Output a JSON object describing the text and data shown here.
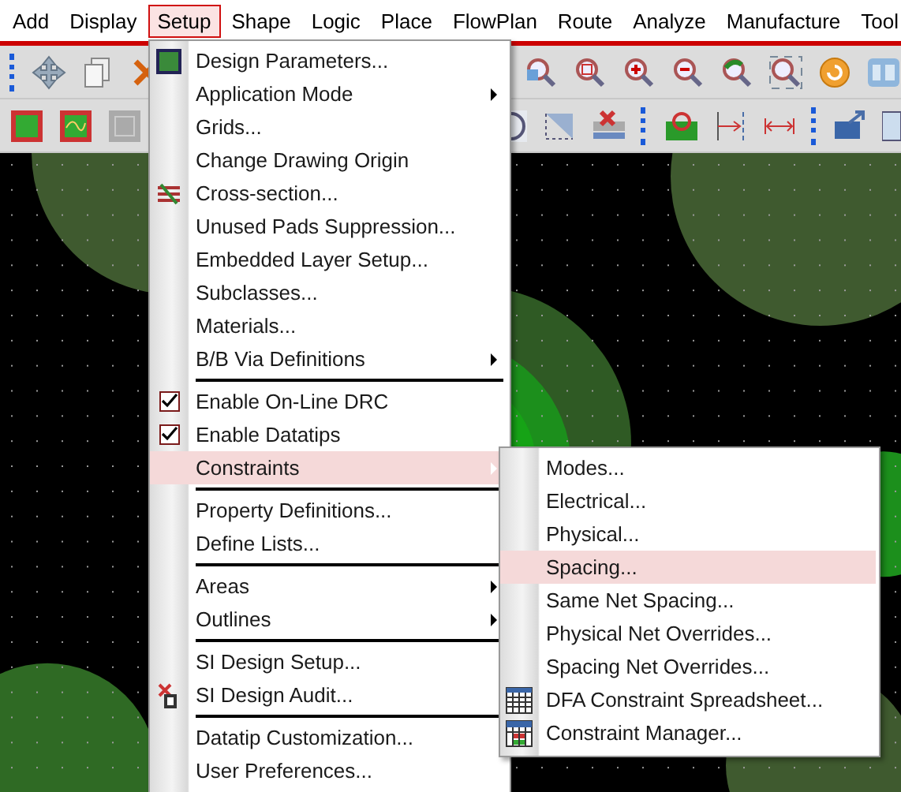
{
  "menu_bar": [
    {
      "label": "Add",
      "selected": false
    },
    {
      "label": "Display",
      "selected": false
    },
    {
      "label": "Setup",
      "selected": true
    },
    {
      "label": "Shape",
      "selected": false
    },
    {
      "label": "Logic",
      "selected": false
    },
    {
      "label": "Place",
      "selected": false
    },
    {
      "label": "FlowPlan",
      "selected": false
    },
    {
      "label": "Route",
      "selected": false
    },
    {
      "label": "Analyze",
      "selected": false
    },
    {
      "label": "Manufacture",
      "selected": false
    },
    {
      "label": "Tool",
      "selected": false
    }
  ],
  "setup_menu": [
    {
      "kind": "item",
      "label": "Design Parameters...",
      "submenu": false,
      "checked": false,
      "selected": false
    },
    {
      "kind": "item",
      "label": "Application Mode",
      "submenu": true,
      "checked": false,
      "selected": false
    },
    {
      "kind": "item",
      "label": "Grids...",
      "submenu": false,
      "checked": false,
      "selected": false
    },
    {
      "kind": "item",
      "label": "Change Drawing Origin",
      "submenu": false,
      "checked": false,
      "selected": false
    },
    {
      "kind": "item",
      "label": "Cross-section...",
      "submenu": false,
      "checked": false,
      "selected": false
    },
    {
      "kind": "item",
      "label": "Unused Pads Suppression...",
      "submenu": false,
      "checked": false,
      "selected": false
    },
    {
      "kind": "item",
      "label": "Embedded Layer Setup...",
      "submenu": false,
      "checked": false,
      "selected": false
    },
    {
      "kind": "item",
      "label": "Subclasses...",
      "submenu": false,
      "checked": false,
      "selected": false
    },
    {
      "kind": "item",
      "label": "Materials...",
      "submenu": false,
      "checked": false,
      "selected": false
    },
    {
      "kind": "item",
      "label": "B/B Via Definitions",
      "submenu": true,
      "checked": false,
      "selected": false
    },
    {
      "kind": "separator"
    },
    {
      "kind": "item",
      "label": "Enable On-Line DRC",
      "submenu": false,
      "checked": true,
      "selected": false
    },
    {
      "kind": "item",
      "label": "Enable Datatips",
      "submenu": false,
      "checked": true,
      "selected": false
    },
    {
      "kind": "item",
      "label": "Constraints",
      "submenu": true,
      "checked": false,
      "selected": true
    },
    {
      "kind": "separator"
    },
    {
      "kind": "item",
      "label": "Property Definitions...",
      "submenu": false,
      "checked": false,
      "selected": false
    },
    {
      "kind": "item",
      "label": "Define Lists...",
      "submenu": false,
      "checked": false,
      "selected": false
    },
    {
      "kind": "separator"
    },
    {
      "kind": "item",
      "label": "Areas",
      "submenu": true,
      "checked": false,
      "selected": false
    },
    {
      "kind": "item",
      "label": "Outlines",
      "submenu": true,
      "checked": false,
      "selected": false
    },
    {
      "kind": "separator"
    },
    {
      "kind": "item",
      "label": "SI Design Setup...",
      "submenu": false,
      "checked": false,
      "selected": false
    },
    {
      "kind": "item",
      "label": "SI Design Audit...",
      "submenu": false,
      "checked": false,
      "selected": false
    },
    {
      "kind": "separator"
    },
    {
      "kind": "item",
      "label": "Datatip Customization...",
      "submenu": false,
      "checked": false,
      "selected": false
    },
    {
      "kind": "item",
      "label": "User Preferences...",
      "submenu": false,
      "checked": false,
      "selected": false
    }
  ],
  "constraints_submenu": [
    {
      "label": "Modes...",
      "selected": false
    },
    {
      "label": "Electrical...",
      "selected": false
    },
    {
      "label": "Physical...",
      "selected": false
    },
    {
      "label": "Spacing...",
      "selected": true
    },
    {
      "label": "Same Net Spacing...",
      "selected": false
    },
    {
      "label": "Physical Net Overrides...",
      "selected": false
    },
    {
      "label": "Spacing Net Overrides...",
      "selected": false
    },
    {
      "label": "DFA Constraint Spreadsheet...",
      "selected": false
    },
    {
      "label": "Constraint Manager...",
      "selected": false
    }
  ]
}
